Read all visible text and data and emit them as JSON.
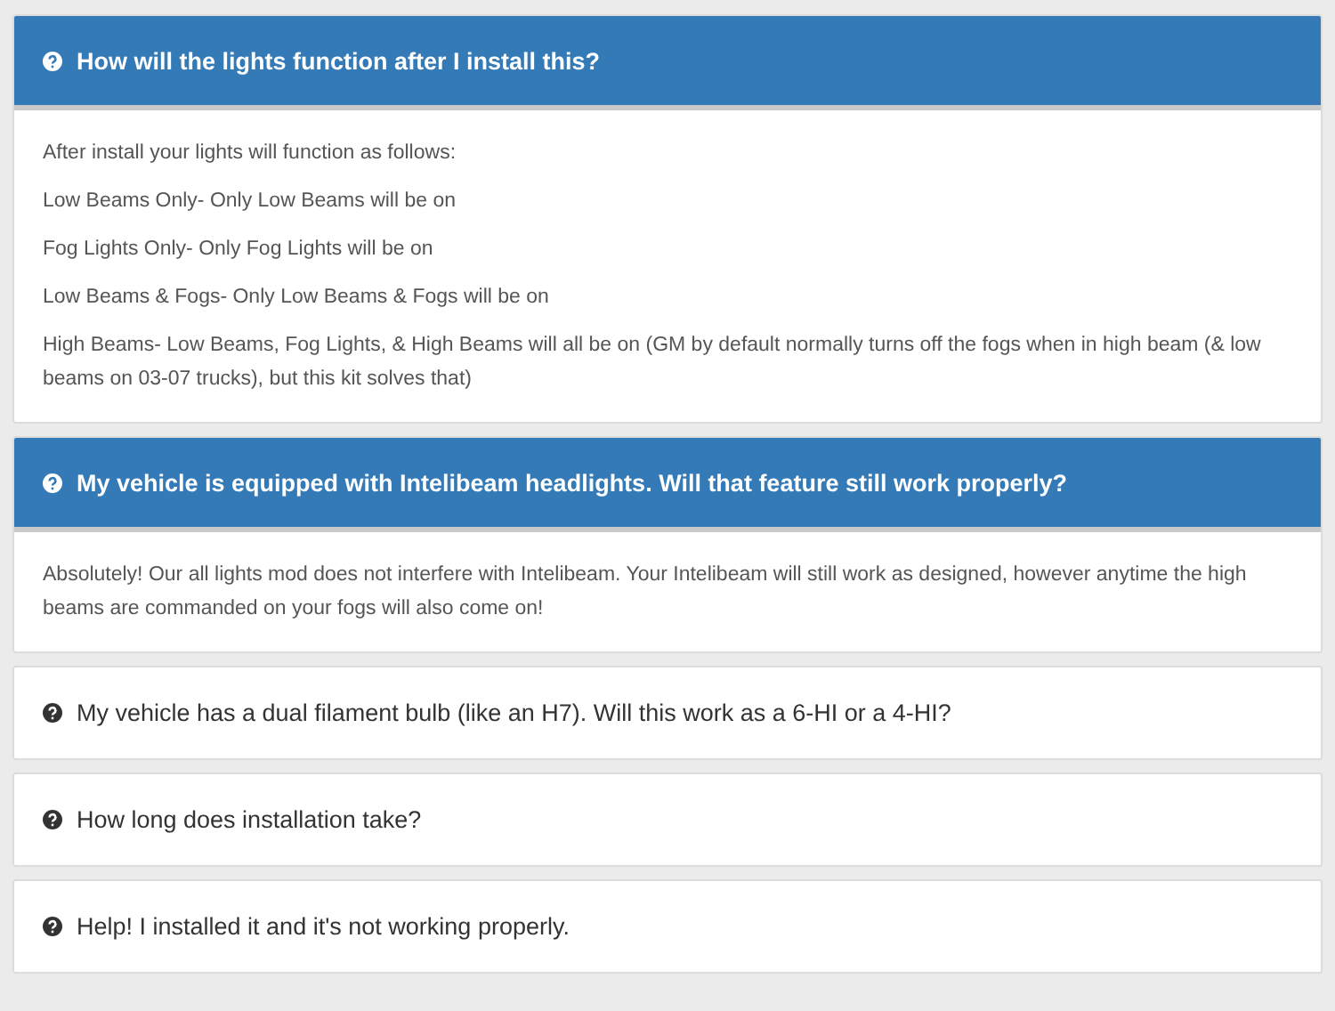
{
  "faqs": [
    {
      "question": "How will the lights function after I install this?",
      "expanded": true,
      "answer": [
        "After install your lights will function as follows:",
        "Low Beams Only- Only Low Beams will be on",
        "Fog Lights Only- Only Fog Lights will be on",
        "Low Beams & Fogs- Only Low Beams & Fogs will be on",
        "High Beams- Low Beams, Fog Lights, & High Beams will all be on (GM by default normally turns off the fogs when in high beam (& low beams on 03-07 trucks), but this kit solves that)"
      ]
    },
    {
      "question": "My vehicle is equipped with Intelibeam headlights. Will that feature still work properly?",
      "expanded": true,
      "answer": [
        "Absolutely! Our all lights mod does not interfere with Intelibeam. Your Intelibeam will still work as designed, however anytime the high beams are commanded on your fogs will also come on!"
      ]
    },
    {
      "question": "My vehicle has a dual filament bulb (like an H7). Will this work as a 6-HI or a 4-HI?",
      "expanded": false
    },
    {
      "question": "How long does installation take?",
      "expanded": false
    },
    {
      "question": "Help! I installed it and it's not working properly.",
      "expanded": false
    }
  ]
}
